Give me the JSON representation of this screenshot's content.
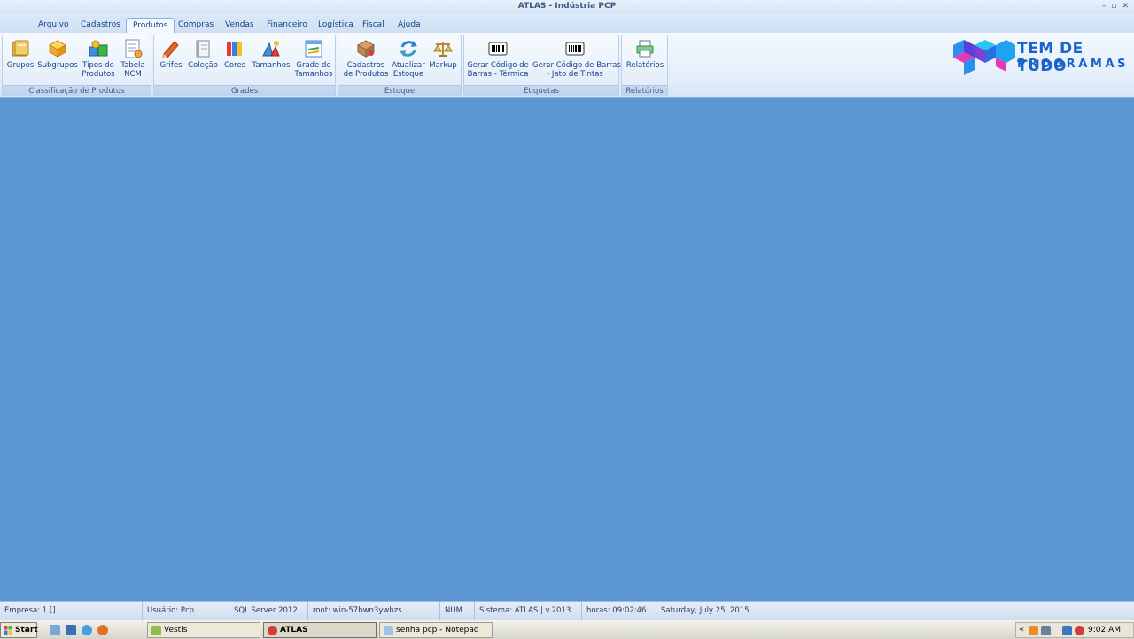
{
  "window": {
    "title": "ATLAS - Indústria PCP",
    "minimize": "–",
    "maximize": "▫",
    "close": "✕"
  },
  "tabs": [
    "Arquivo",
    "Cadastros",
    "Produtos",
    "Compras",
    "Vendas",
    "Financeiro",
    "Logística",
    "Fiscal",
    "Ajuda"
  ],
  "active_tab": "Produtos",
  "ribbon": {
    "groups": [
      {
        "label": "Classificação de Produtos",
        "buttons": [
          {
            "line1": "Grupos",
            "line2": ""
          },
          {
            "line1": "Subgrupos",
            "line2": ""
          },
          {
            "line1": "Tipos de",
            "line2": "Produtos"
          },
          {
            "line1": "Tabela",
            "line2": "NCM"
          }
        ]
      },
      {
        "label": "Grades",
        "buttons": [
          {
            "line1": "Grifes",
            "line2": ""
          },
          {
            "line1": "Coleção",
            "line2": ""
          },
          {
            "line1": "Cores",
            "line2": ""
          },
          {
            "line1": "Tamanhos",
            "line2": ""
          },
          {
            "line1": "Grade de",
            "line2": "Tamanhos"
          }
        ]
      },
      {
        "label": "Estoque",
        "buttons": [
          {
            "line1": "Cadastros",
            "line2": "de Produtos"
          },
          {
            "line1": "Atualizar",
            "line2": "Estoque"
          },
          {
            "line1": "Markup",
            "line2": ""
          }
        ]
      },
      {
        "label": "Etiquetas",
        "buttons": [
          {
            "line1": "Gerar Código de",
            "line2": "Barras - Térmica"
          },
          {
            "line1": "Gerar Código de Barras",
            "line2": "- Jato de Tintas"
          }
        ]
      },
      {
        "label": "Relatórios",
        "buttons": [
          {
            "line1": "Relatórios",
            "line2": ""
          }
        ]
      }
    ]
  },
  "logo": {
    "line1": "TEM DE TUDO",
    "line2": "PROGRAMAS",
    "color": "#1a63c9"
  },
  "status": {
    "empresa": "Empresa: 1 []",
    "usuario": "Usuário: Pcp",
    "server": "SQL Server 2012",
    "root": "root: win-57bwn3ywbzs",
    "num": "NUM",
    "sistema": "Sistema: ATLAS | v.2013",
    "horas": "horas: 09:02:46",
    "date": "Saturday, July 25, 2015"
  },
  "taskbar": {
    "start": "Start",
    "tasks": [
      "Vestis",
      "ATLAS",
      "senha pcp - Notepad"
    ],
    "active_task": "ATLAS",
    "tray_chevron": "«",
    "clock": "9:02 AM"
  },
  "colors": {
    "workspace": "#5b96d2",
    "accent": "#15428b"
  }
}
